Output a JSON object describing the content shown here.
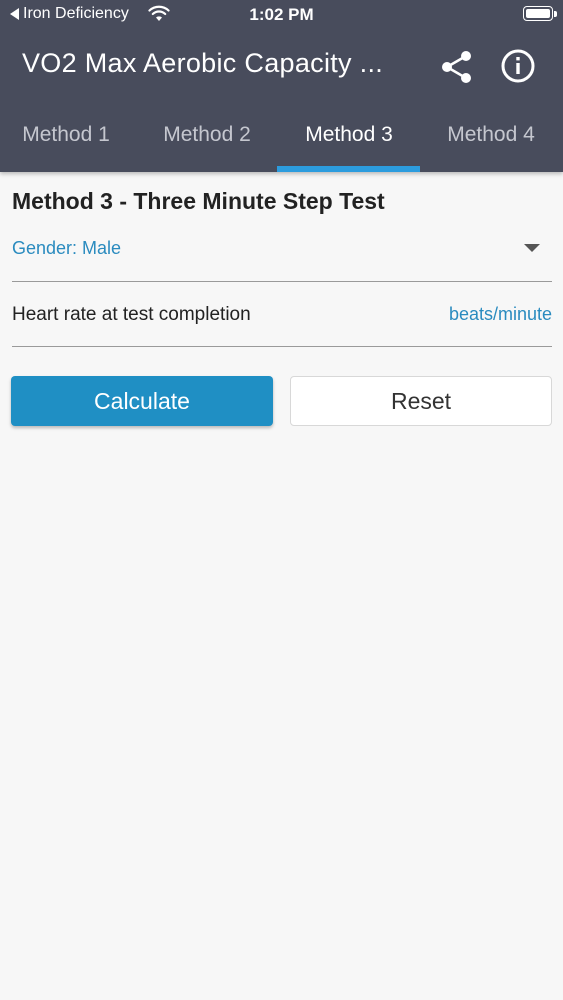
{
  "status_bar": {
    "back_app": "Iron Deficiency",
    "time": "1:02 PM"
  },
  "app_bar": {
    "title": "VO2 Max Aerobic Capacity ...",
    "actions": [
      "share-icon",
      "info-icon"
    ]
  },
  "tabs": [
    {
      "label": "Method 1",
      "active": false
    },
    {
      "label": "Method 2",
      "active": false
    },
    {
      "label": "Method 3",
      "active": true
    },
    {
      "label": "Method 4",
      "active": false
    }
  ],
  "form": {
    "heading": "Method 3 - Three Minute Step Test",
    "gender_label": "Gender: Male",
    "heart_rate_label": "Heart rate at test completion",
    "heart_rate_unit": "beats/minute",
    "calculate_label": "Calculate",
    "reset_label": "Reset"
  },
  "colors": {
    "app_bar": "#484c5c",
    "accent": "#2c9cde",
    "primary_button": "#1f8fc4",
    "link_text": "#2a8bbf"
  }
}
